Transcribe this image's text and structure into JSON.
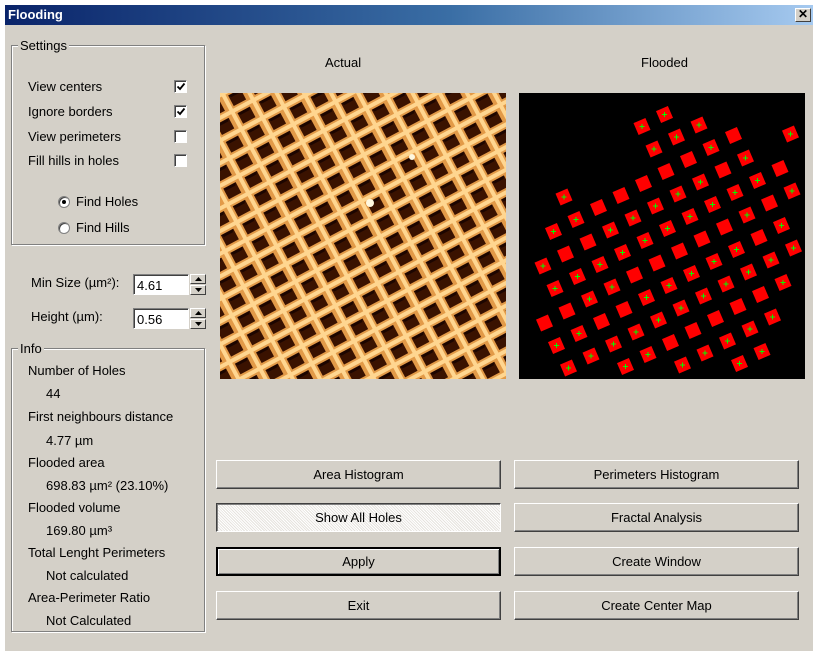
{
  "window": {
    "title": "Flooding",
    "close_glyph": "✕"
  },
  "settings": {
    "legend": "Settings",
    "checkboxes": [
      {
        "label": "View centers",
        "checked": true
      },
      {
        "label": "Ignore borders",
        "checked": true
      },
      {
        "label": "View perimeters",
        "checked": false
      },
      {
        "label": "Fill hills in holes",
        "checked": false
      }
    ],
    "radios": [
      {
        "label": "Find Holes",
        "selected": true
      },
      {
        "label": "Find Hills",
        "selected": false
      }
    ]
  },
  "params": {
    "min_size_label": "Min Size (µm²):",
    "min_size_value": "4.61",
    "height_label": "Height (µm):",
    "height_value": "0.56"
  },
  "info": {
    "legend": "Info",
    "items": [
      {
        "label": "Number of Holes",
        "value": "44"
      },
      {
        "label": "First neighbours distance",
        "value": "4.77 µm"
      },
      {
        "label": "Flooded area",
        "value": "698.83 µm² (23.10%)"
      },
      {
        "label": "Flooded volume",
        "value": "169.80 µm³"
      },
      {
        "label": "Total Lenght Perimeters",
        "value": "Not calculated"
      },
      {
        "label": "Area-Perimeter Ratio",
        "value": "Not Calculated"
      }
    ]
  },
  "images": {
    "actual_label": "Actual",
    "flooded_label": "Flooded"
  },
  "buttons": {
    "area_histogram": "Area Histogram",
    "perimeters_histogram": "Perimeters Histogram",
    "show_all_holes": "Show All Holes",
    "fractal_analysis": "Fractal Analysis",
    "apply": "Apply",
    "create_window": "Create Window",
    "exit": "Exit",
    "create_center_map": "Create Center Map"
  },
  "colors": {
    "afm_light": "#f7c87a",
    "afm_dark": "#3a1200",
    "hole_fill": "#ff0000",
    "center_marker": "#00ff00"
  }
}
